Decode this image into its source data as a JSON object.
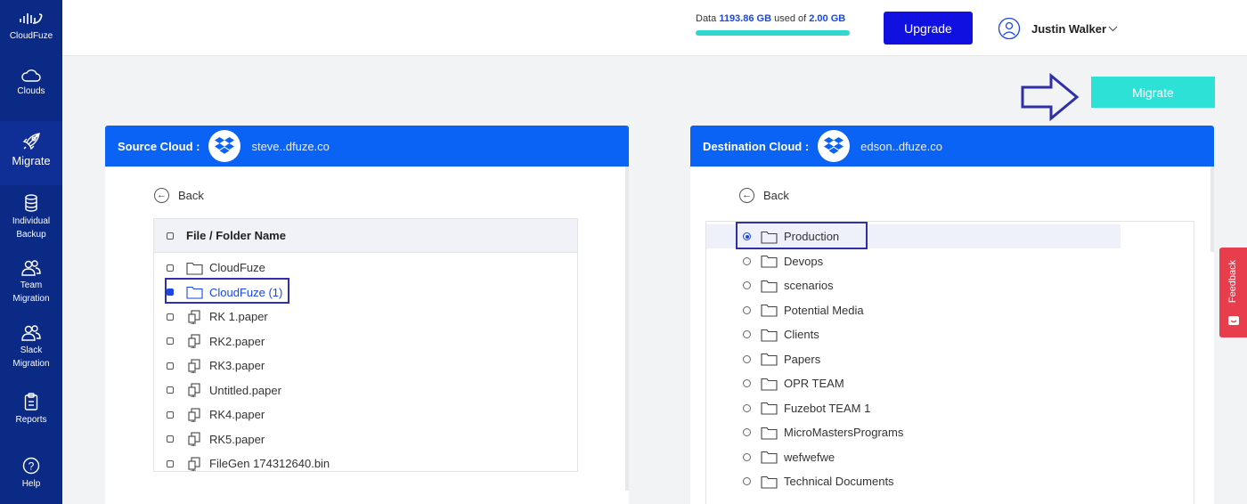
{
  "sidebar": {
    "brand": "CloudFuze",
    "items": [
      {
        "label": "Clouds"
      },
      {
        "label": "Migrate"
      },
      {
        "label": "Individual Backup"
      },
      {
        "label": "Team Migration"
      },
      {
        "label": "Slack Migration"
      },
      {
        "label": "Reports"
      },
      {
        "label": "Help"
      }
    ]
  },
  "topbar": {
    "storage_prefix": "Data",
    "storage_used": "1193.86 GB",
    "storage_mid": "used of",
    "storage_total": "2.00 GB",
    "storage_fill": 1.0,
    "upgrade_label": "Upgrade",
    "user_name": "Justin Walker"
  },
  "migrate_label": "Migrate",
  "source": {
    "title": "Source Cloud :",
    "account": "steve..dfuze.co",
    "back_label": "Back",
    "header": "File / Folder Name",
    "items": [
      {
        "name": "CloudFuze",
        "type": "folder",
        "checked": false
      },
      {
        "name": "CloudFuze (1)",
        "type": "folder",
        "checked": true
      },
      {
        "name": "RK 1.paper",
        "type": "file",
        "checked": false
      },
      {
        "name": "RK2.paper",
        "type": "file",
        "checked": false
      },
      {
        "name": "RK3.paper",
        "type": "file",
        "checked": false
      },
      {
        "name": "Untitled.paper",
        "type": "file",
        "checked": false
      },
      {
        "name": "RK4.paper",
        "type": "file",
        "checked": false
      },
      {
        "name": "RK5.paper",
        "type": "file",
        "checked": false
      },
      {
        "name": "FileGen 174312640.bin",
        "type": "file",
        "checked": false
      }
    ]
  },
  "destination": {
    "title": "Destination Cloud :",
    "account": "edson..dfuze.co",
    "back_label": "Back",
    "items": [
      {
        "name": "Production",
        "selected": true
      },
      {
        "name": "Devops",
        "selected": false
      },
      {
        "name": "scenarios",
        "selected": false
      },
      {
        "name": "Potential Media",
        "selected": false
      },
      {
        "name": "Clients",
        "selected": false
      },
      {
        "name": "Papers",
        "selected": false
      },
      {
        "name": "OPR TEAM",
        "selected": false
      },
      {
        "name": "Fuzebot TEAM 1",
        "selected": false
      },
      {
        "name": "MicroMastersPrograms",
        "selected": false
      },
      {
        "name": "wefwefwe",
        "selected": false
      },
      {
        "name": "Technical Documents",
        "selected": false
      }
    ]
  },
  "feedback_label": "Feedback",
  "colors": {
    "sidebar": "#0b2a86",
    "panel_header": "#0a63f5",
    "accent": "#1a47e6",
    "migrate": "#2ee1d7",
    "upgrade": "#1010e0",
    "feedback": "#e83d4c"
  }
}
